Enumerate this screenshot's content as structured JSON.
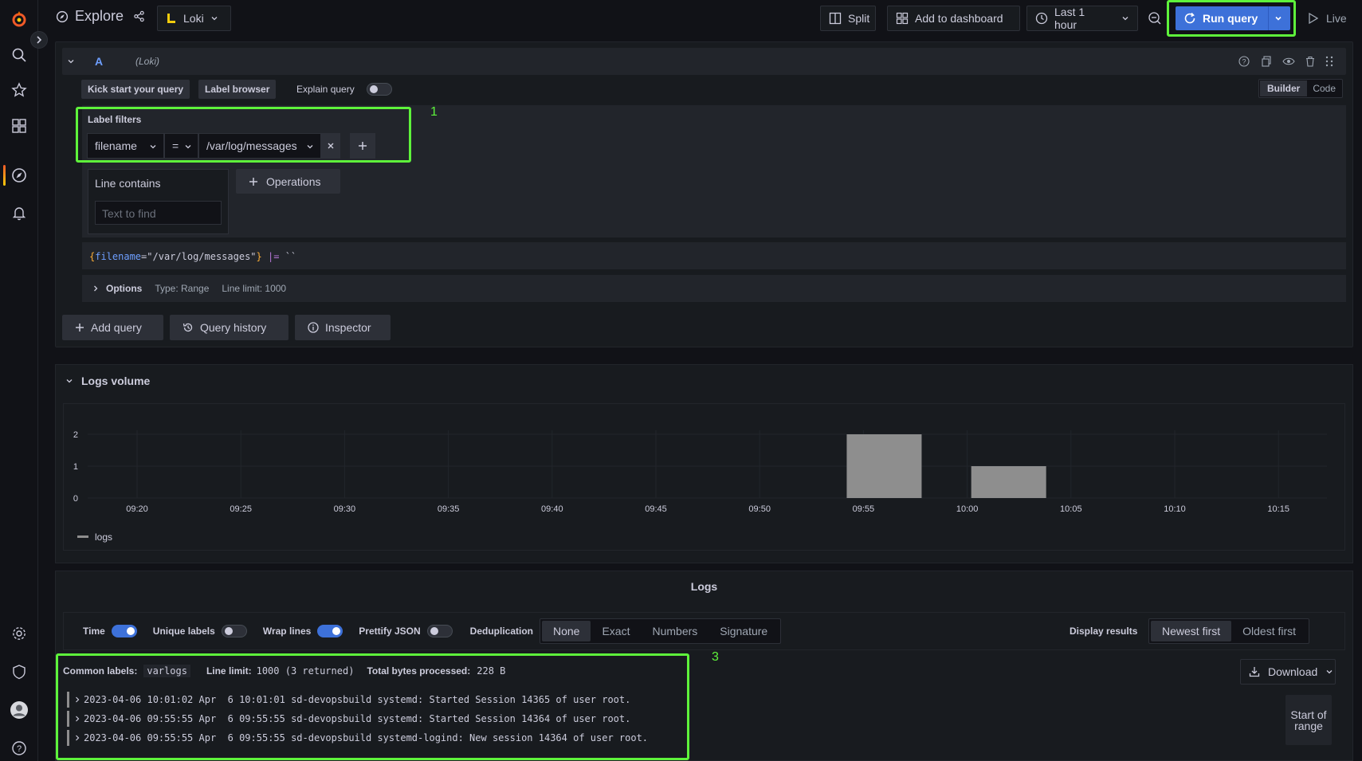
{
  "sidebar": {
    "items": [
      {
        "icon": "grafana-logo-icon"
      },
      {
        "icon": "search-icon"
      },
      {
        "icon": "star-icon"
      },
      {
        "icon": "dashboards-icon"
      },
      {
        "icon": "explore-icon"
      },
      {
        "icon": "alerting-bell-icon"
      },
      {
        "icon": "gear-icon"
      },
      {
        "icon": "shield-icon"
      },
      {
        "icon": "avatar"
      },
      {
        "icon": "help-icon"
      }
    ]
  },
  "topbar": {
    "title": "Explore",
    "datasource": "Loki",
    "split_label": "Split",
    "add_dashboard_label": "Add to dashboard",
    "time_range": "Last 1 hour",
    "run_query_label": "Run query",
    "live_label": "Live"
  },
  "query": {
    "ref_id": "A",
    "datasource_tag": "(Loki)",
    "kick_start_label": "Kick start your query",
    "label_browser_label": "Label browser",
    "explain_label": "Explain query",
    "mode_builder": "Builder",
    "mode_code": "Code",
    "label_filters_title": "Label filters",
    "filter_label": "filename",
    "filter_op": "=",
    "filter_value": "/var/log/messages",
    "line_contains_title": "Line contains",
    "line_contains_placeholder": "Text to find",
    "operations_label": "Operations",
    "preview_open": "{",
    "preview_key": "filename",
    "preview_eq": "=",
    "preview_value": "\"/var/log/messages\"",
    "preview_close": "}",
    "preview_pipe": "|=",
    "preview_literal": "``",
    "options_label": "Options",
    "options_type": "Type: Range",
    "options_limit": "Line limit: 1000",
    "annotation": "1"
  },
  "actions": {
    "add_query": "Add query",
    "query_history": "Query history",
    "inspector": "Inspector"
  },
  "volume": {
    "title": "Logs volume",
    "legend": "logs"
  },
  "chart_data": {
    "type": "bar",
    "categories": [
      "09:20",
      "09:25",
      "09:30",
      "09:35",
      "09:40",
      "09:45",
      "09:50",
      "09:55",
      "10:00",
      "10:05",
      "10:10",
      "10:15"
    ],
    "yticks": [
      "0",
      "1",
      "2"
    ],
    "series": [
      {
        "name": "logs",
        "bars": [
          {
            "time": "09:56",
            "value": 2
          },
          {
            "time": "10:02",
            "value": 1
          }
        ]
      }
    ],
    "ylim": [
      0,
      2
    ],
    "grid": true,
    "legend_placement": "bottom-left"
  },
  "logs": {
    "title": "Logs",
    "time_label": "Time",
    "unique_labels_label": "Unique labels",
    "wrap_lines_label": "Wrap lines",
    "prettify_label": "Prettify JSON",
    "dedup_label": "Deduplication",
    "dedup_options": [
      "None",
      "Exact",
      "Numbers",
      "Signature"
    ],
    "display_results_label": "Display results",
    "order_options": [
      "Newest first",
      "Oldest first"
    ],
    "common_labels_label": "Common labels:",
    "common_labels_value": "varlogs",
    "line_limit_label": "Line limit:",
    "line_limit_value": "1000 (3 returned)",
    "bytes_label": "Total bytes processed:",
    "bytes_value": "228 B",
    "download_label": "Download",
    "start_of_range": "Start of range",
    "annotation": "3",
    "lines": [
      "2023-04-06 10:01:02 Apr  6 10:01:01 sd-devopsbuild systemd: Started Session 14365 of user root.",
      "2023-04-06 09:55:55 Apr  6 09:55:55 sd-devopsbuild systemd: Started Session 14364 of user root.",
      "2023-04-06 09:55:55 Apr  6 09:55:55 sd-devopsbuild systemd-logind: New session 14364 of user root."
    ]
  }
}
